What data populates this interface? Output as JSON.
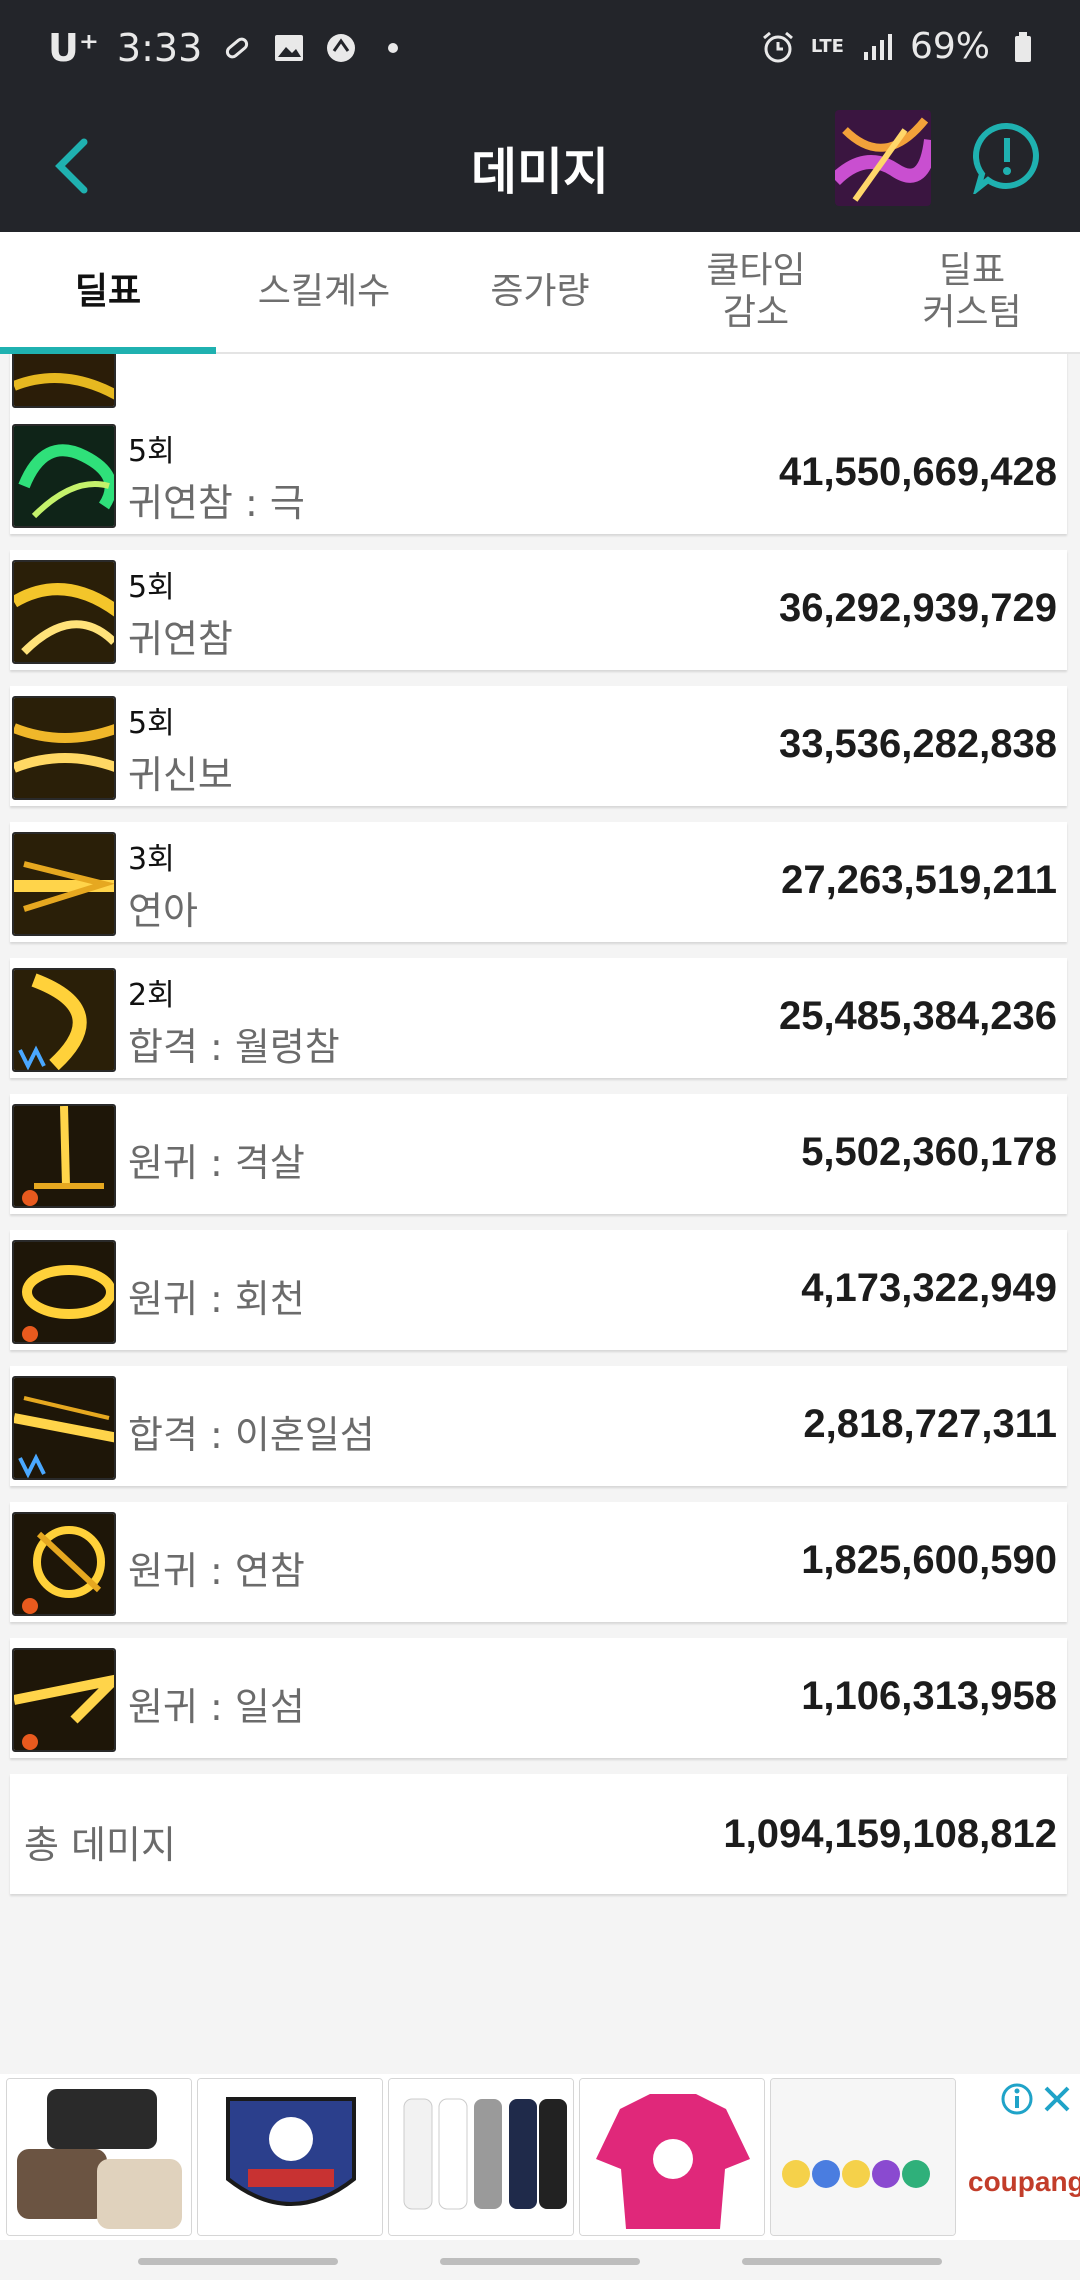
{
  "status_bar": {
    "carrier": "U⁺",
    "time": "3:33",
    "network": "LTE",
    "battery": "69%"
  },
  "app_bar": {
    "title": "데미지"
  },
  "tabs": [
    {
      "label": "딜표",
      "active": true
    },
    {
      "label": "스킬계수",
      "active": false
    },
    {
      "label": "증가량",
      "active": false
    },
    {
      "label": "쿨타임\n감소",
      "active": false
    },
    {
      "label": "딜표\n커스텀",
      "active": false
    }
  ],
  "skills": [
    {
      "count": "5회",
      "name": "귀연참 : 극",
      "damage": "41,550,669,428",
      "icon": "green-swirl-icon"
    },
    {
      "count": "5회",
      "name": "귀연참",
      "damage": "36,292,939,729",
      "icon": "gold-swirl-icon"
    },
    {
      "count": "5회",
      "name": "귀신보",
      "damage": "33,536,282,838",
      "icon": "gold-wave-icon"
    },
    {
      "count": "3회",
      "name": "연아",
      "damage": "27,263,519,211",
      "icon": "gold-arrow-icon"
    },
    {
      "count": "2회",
      "name": "합격 : 월령참",
      "damage": "25,485,384,236",
      "icon": "gold-crescent-icon"
    },
    {
      "count": "",
      "name": "원귀 : 격살",
      "damage": "5,502,360,178",
      "icon": "gold-strike-icon"
    },
    {
      "count": "",
      "name": "원귀 : 회천",
      "damage": "4,173,322,949",
      "icon": "gold-spin-icon"
    },
    {
      "count": "",
      "name": "합격 : 이혼일섬",
      "damage": "2,818,727,311",
      "icon": "gold-slash-icon"
    },
    {
      "count": "",
      "name": "원귀 : 연참",
      "damage": "1,825,600,590",
      "icon": "gold-ring-icon"
    },
    {
      "count": "",
      "name": "원귀 : 일섬",
      "damage": "1,106,313,958",
      "icon": "gold-flash-icon"
    }
  ],
  "total": {
    "label": "총 데미지",
    "value": "1,094,159,108,812"
  },
  "ad": {
    "brand": "coupang"
  },
  "colors": {
    "accent": "#1fb1b0",
    "header_bg": "#23252a"
  }
}
